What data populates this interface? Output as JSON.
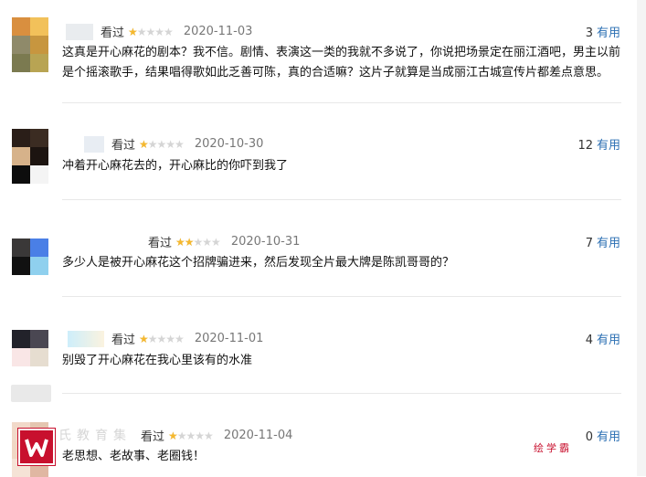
{
  "reviews": [
    {
      "rating_label": "看过",
      "stars": 1,
      "date": "2020-11-03",
      "useful_count": "3",
      "useful_label": "有用",
      "content": "这真是开心麻花的剧本？我不信。剧情、表演这一类的我就不多说了，你说把场景定在丽江酒吧，男主以前是个摇滚歌手，结果唱得歌如此乏善可陈，真的合适嘛？这片子就算是当成丽江古城宣传片都差点意思。"
    },
    {
      "rating_label": "看过",
      "stars": 1,
      "date": "2020-10-30",
      "useful_count": "12",
      "useful_label": "有用",
      "content": "冲着开心麻花去的，开心麻比的你吓到我了"
    },
    {
      "rating_label": "看过",
      "stars": 2,
      "date": "2020-10-31",
      "useful_count": "7",
      "useful_label": "有用",
      "content": "多少人是被开心麻花这个招牌骗进来，然后发现全片最大牌是陈凯哥哥的？"
    },
    {
      "rating_label": "看过",
      "stars": 1,
      "date": "2020-11-01",
      "useful_count": "4",
      "useful_label": "有用",
      "content": "别毁了开心麻花在我心里该有的水准"
    },
    {
      "rating_label": "看过",
      "stars": 1,
      "date": "2020-11-04",
      "useful_count": "0",
      "useful_label": "有用",
      "content": "老思想、老故事、老圈钱！"
    }
  ],
  "star_symbol": "★★★★★",
  "colors": {
    "star": "#f5b82e",
    "link": "#2b6fb3",
    "logo": "#c8102e"
  },
  "watermarks": {
    "left": "氏教育集",
    "right": "绘学霸"
  }
}
